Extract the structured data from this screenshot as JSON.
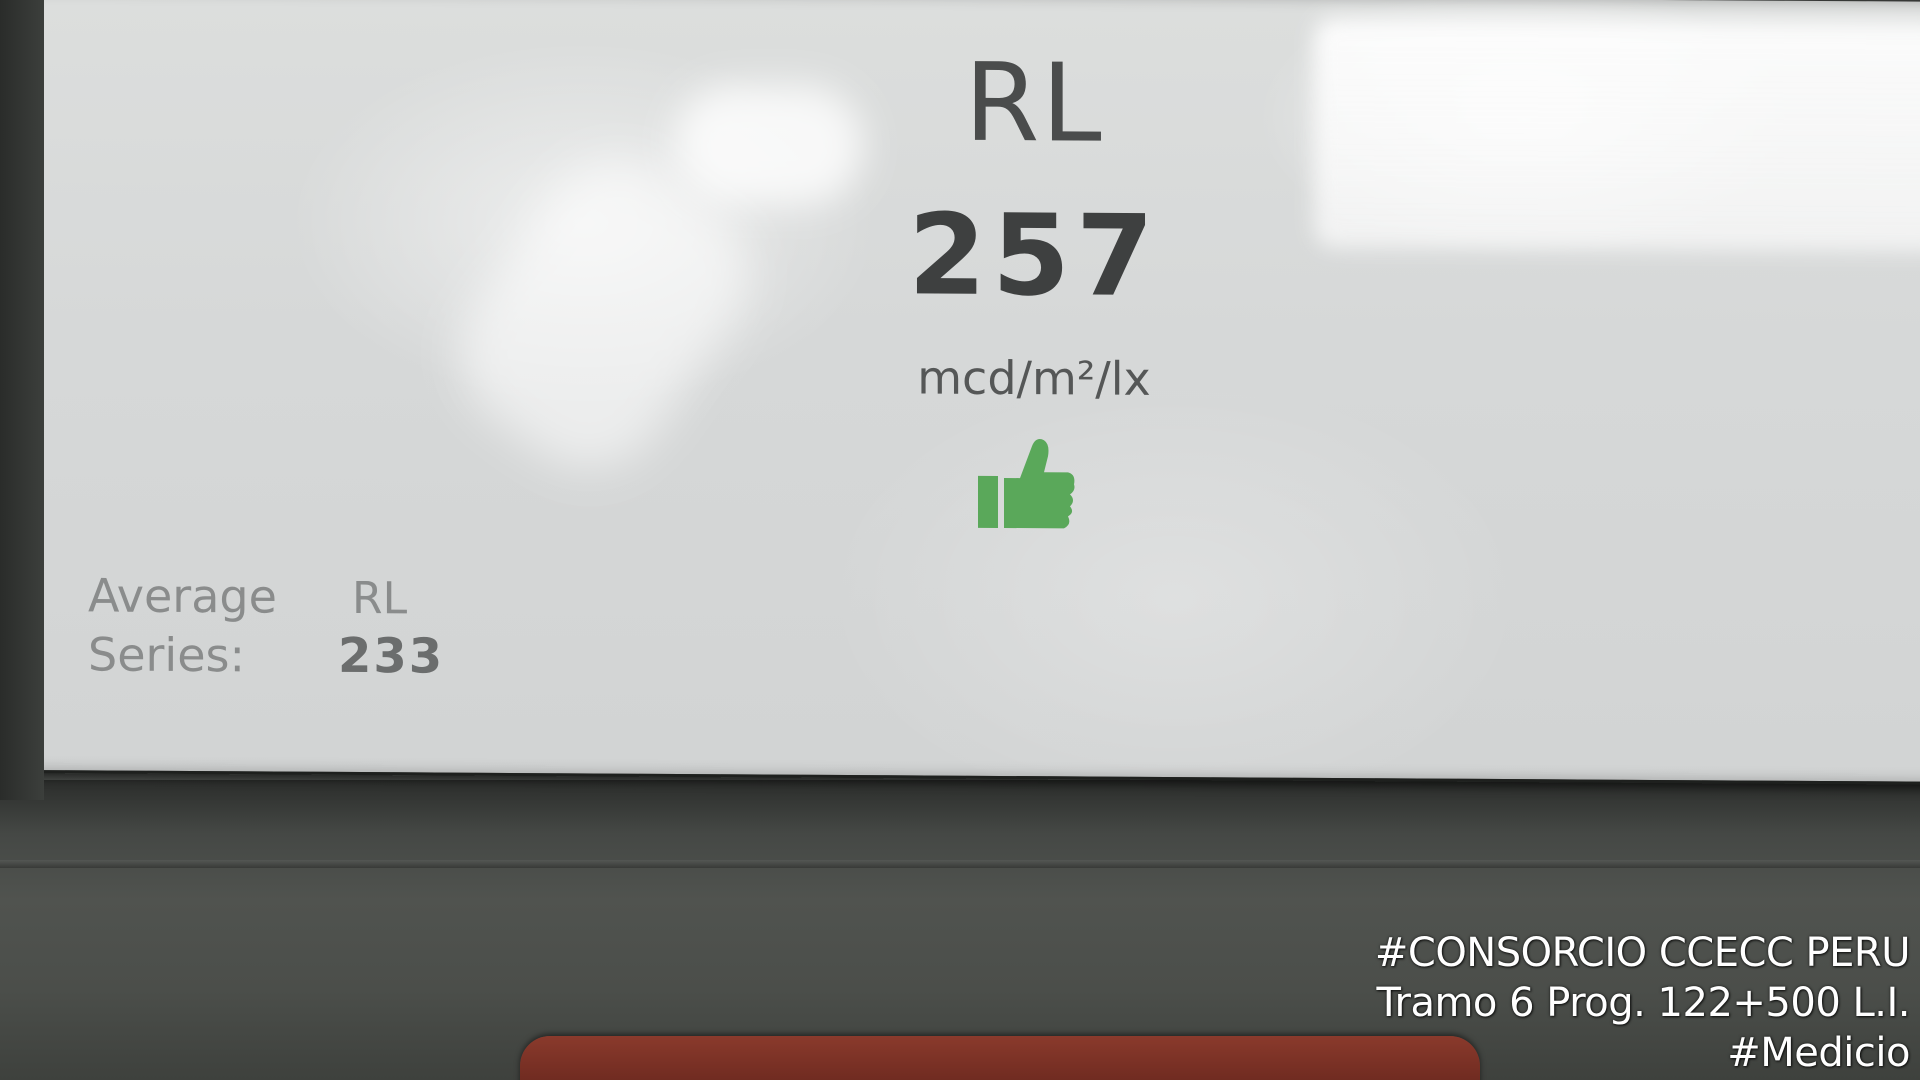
{
  "screen": {
    "measurement_label": "RL",
    "measurement_value": "257",
    "unit": "mcd/m²/lx",
    "status_icon": "thumbs-up-icon",
    "status_color": "#5aa85a",
    "average": {
      "label_line1": "Average",
      "label_line2": "Series:",
      "rl_label": "RL",
      "value": "233"
    }
  },
  "watermark": {
    "line1": "#CONSORCIO CCECC PERU",
    "line2": "Tramo 6 Prog. 122+500 L.I.",
    "line3": "#Medicio"
  }
}
